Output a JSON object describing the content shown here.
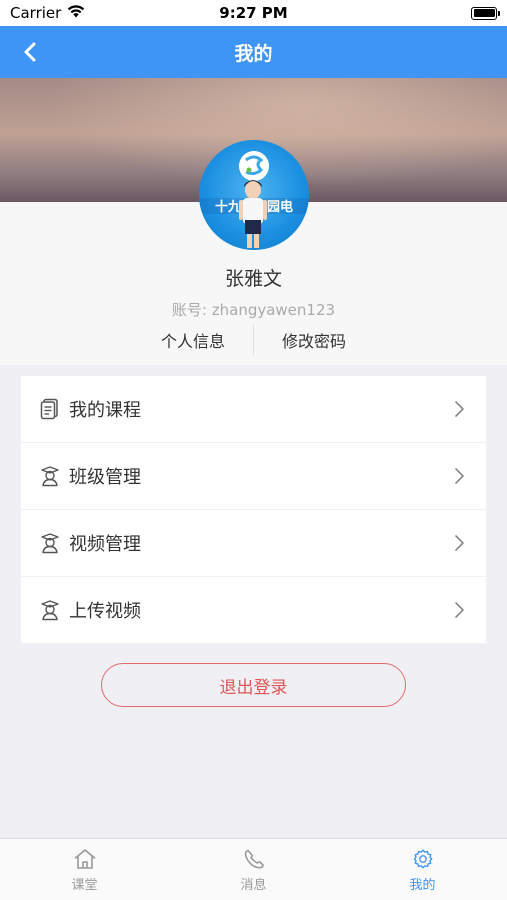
{
  "status_bar": {
    "carrier": "Carrier",
    "time": "9:27 PM"
  },
  "nav": {
    "title": "我的",
    "back_icon": "chevron-left-icon"
  },
  "profile": {
    "name": "张雅文",
    "account": "账号: zhangyawen123",
    "avatar_text": "十九届校园电",
    "links": [
      {
        "label": "个人信息"
      },
      {
        "label": "修改密码"
      }
    ]
  },
  "menu": {
    "items": [
      {
        "label": "我的课程",
        "icon": "document-icon"
      },
      {
        "label": "班级管理",
        "icon": "graduate-icon"
      },
      {
        "label": "视频管理",
        "icon": "graduate-icon"
      },
      {
        "label": "上传视频",
        "icon": "graduate-icon"
      }
    ]
  },
  "logout": {
    "label": "退出登录"
  },
  "tab_bar": {
    "tabs": [
      {
        "label": "课堂",
        "icon": "home-icon",
        "active": false
      },
      {
        "label": "消息",
        "icon": "phone-icon",
        "active": false
      },
      {
        "label": "我的",
        "icon": "gear-icon",
        "active": true
      }
    ]
  },
  "colors": {
    "accent": "#3f95f6",
    "logout_red": "#e05555",
    "background": "#efeff4"
  }
}
